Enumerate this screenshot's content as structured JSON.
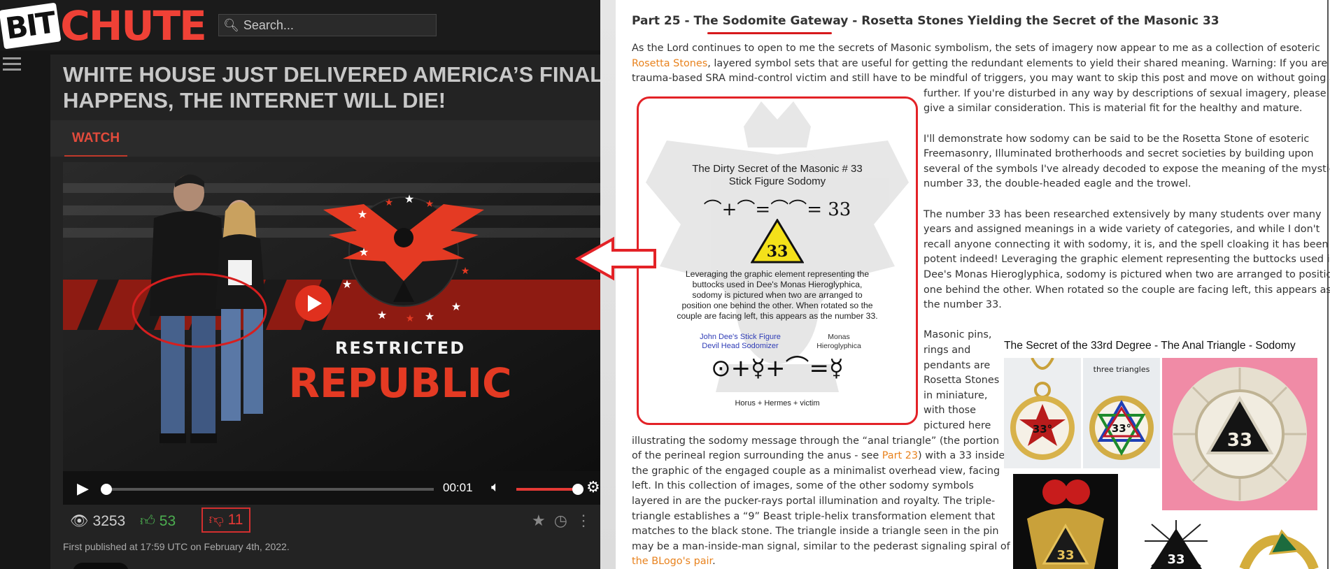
{
  "bitchute": {
    "logo": {
      "part1": "BIT",
      "part2": "CHUTE"
    },
    "search_placeholder": "Search...",
    "video_title_line1": "WHITE HOUSE JUST DELIVERED AMERICA’S FINAL D",
    "video_title_line2": "HAPPENS, THE INTERNET WILL DIE!",
    "tab_watch": "WATCH",
    "thumbnail": {
      "line1": "RESTRICTED",
      "line2": "REPUBLIC"
    },
    "time": "00:01",
    "progress_fraction": 0.0,
    "volume_fraction": 1.0,
    "views": "3253",
    "likes": "53",
    "dislikes": "11",
    "published": "First published at 17:59 UTC on February 4th, 2022.",
    "colors": {
      "accent": "#ef4136",
      "like": "#4caf50",
      "dislike": "#e53935"
    }
  },
  "article": {
    "heading": {
      "pre": "Part 25 - The ",
      "highlight": "Sodomite Gateway",
      "post": " - Rosetta Stones Yielding the Secret of the Masonic 33"
    },
    "p1": {
      "l1": "As the Lord continues to open to me the secrets of Masonic symbolism, the sets of imagery now appear to me as a collection of esoteric",
      "l2_link": "Rosetta Stones",
      "l2_rest": ", layered symbol sets that are useful for getting the redundant elements to yield their shared meaning. Warning: If you are a",
      "l3": "trauma-based SRA mind-control victim and still have to be mindful of triggers, you may want to skip this post and move on without going any",
      "l4": "further. If you're disturbed in any way by descriptions of sexual imagery, please",
      "l5": "give a similar consideration. This is material fit for the healthy and mature."
    },
    "p2": [
      "I'll demonstrate how sodomy can be said to be the Rosetta Stone of esoteric",
      "Freemasonry, Illuminated brotherhoods and secret societies by building upon",
      "several of the symbols I've already decoded to expose the meaning of the mystical",
      "number 33, the double-headed eagle and the trowel."
    ],
    "p3": [
      "The number 33 has been researched extensively by many students over many",
      "years and assigned meanings in a wide variety of categories, and while I don't",
      "recall anyone connecting it with sodomy, it is, and the spell cloaking it has been",
      "potent indeed! Leveraging the graphic element representing the buttocks used in",
      "Dee's Monas Hieroglyphica, sodomy is pictured when two are arranged to position",
      "one behind the other. When rotated so the couple are facing left, this appears as",
      "the number 33."
    ],
    "p4_narrow": [
      "Masonic pins,",
      "rings and",
      "pendants are",
      "Rosetta Stones",
      "in miniature,",
      "with those",
      "pictured here"
    ],
    "p4_wide": [
      "illustrating the sodomy message through the “anal triangle” (the portion",
      "of the perineal region surrounding the anus - see ",
      "the graphic of the engaged couple as a minimalist overhead view, facing",
      "left. In this collection of images, some of the other sodomy symbols",
      "layered in are the pucker-rays portal illumination and royalty. The triple-",
      "triangle establishes a “9” Beast triple-helix transformation element that",
      "matches to the black stone. The triangle inside a triangle seen in the pin",
      "may be a man-inside-man signal, similar to the pederast signaling spiral of"
    ],
    "part23_link": "Part 23",
    "part23_after": ") with a 33 inside,",
    "blogo_link": "the BLogo's pair",
    "blogo_after": ".",
    "figure": {
      "title_line1": "The Dirty Secret of the Masonic # 33",
      "title_line2": "Stick Figure Sodomy",
      "formula": "⌒+⌒=⌒⌒= 33",
      "badge": "33",
      "caption": [
        "Leveraging the graphic element representing the",
        "buttocks used in Dee's Monas Hieroglyphica,",
        "sodomy is pictured when two are arranged to",
        "position one behind the other. When rotated so the",
        "couple are facing left, this appears as the number 33."
      ],
      "label_dee": [
        "John Dee's Stick Figure",
        "Devil Head Sodomizer"
      ],
      "label_monas": [
        "Monas",
        "Hieroglyphica"
      ],
      "glyphs": "⊙+☿+⌒=☿",
      "bottom": "Horus + Hermes + victim"
    },
    "collage": {
      "caption": "The Secret of the 33rd Degree - The Anal Triangle - Sodomy",
      "pin1": "33°",
      "pin2_label": "three triangles",
      "pin2": "33°",
      "pin3": "33",
      "pin4": "33",
      "pin5": "33"
    }
  }
}
